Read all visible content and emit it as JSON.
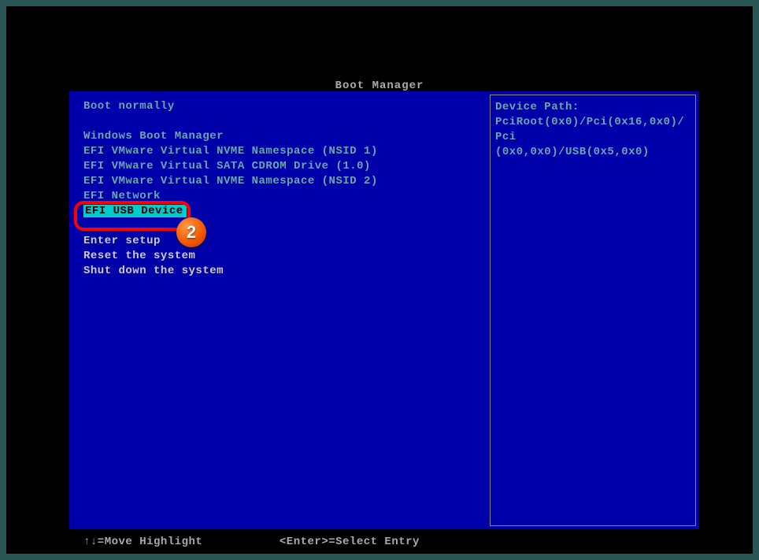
{
  "title": "Boot Manager",
  "menu": {
    "boot_normally": "Boot normally",
    "items": [
      "Windows Boot Manager",
      "EFI VMware Virtual NVME Namespace (NSID 1)",
      "EFI VMware Virtual SATA CDROM Drive (1.0)",
      "EFI VMware Virtual NVME Namespace (NSID 2)",
      "EFI Network",
      "EFI USB Device"
    ],
    "selected": "EFI USB Device",
    "enter_setup": "Enter setup",
    "reset": "Reset the system",
    "shutdown": "Shut down the system"
  },
  "info": {
    "label": "Device Path:",
    "line1": "PciRoot(0x0)/Pci(0x16,0x0)/Pci",
    "line2": "(0x0,0x0)/USB(0x5,0x0)"
  },
  "footer": {
    "hint1": "↑↓=Move Highlight",
    "hint2": "<Enter>=Select Entry"
  },
  "callout": {
    "number": "2"
  }
}
